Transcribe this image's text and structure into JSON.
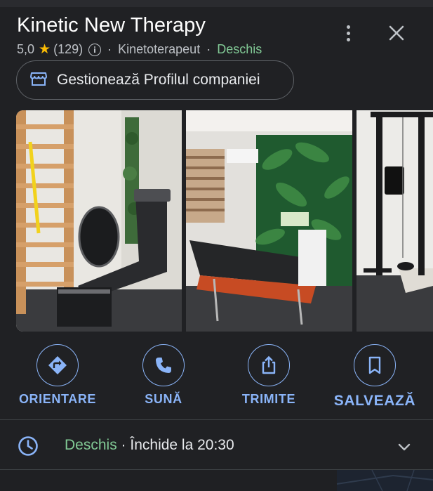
{
  "place": {
    "name": "Kinetic New Therapy",
    "rating": "5,0",
    "reviews": "(129)",
    "category": "Kinetoterapeut",
    "status": "Deschis",
    "separator": "·"
  },
  "header_actions": {
    "more_icon": "more-vert-icon",
    "close_icon": "close-icon"
  },
  "manage_button": {
    "label": "Gestionează Profilul companiei",
    "icon": "storefront-icon"
  },
  "photos": [
    {
      "subject": "wall bars, trampoline and treadmill"
    },
    {
      "subject": "massage table with tropical leaf wallpaper"
    },
    {
      "subject": "pull-up power tower"
    }
  ],
  "actions": [
    {
      "label": "ORIENTARE",
      "icon": "directions-icon"
    },
    {
      "label": "SUNĂ",
      "icon": "phone-icon"
    },
    {
      "label": "TRIMITE",
      "icon": "share-icon"
    },
    {
      "label": "SALVEAZĂ",
      "icon": "bookmark-icon"
    }
  ],
  "hours": {
    "status": "Deschis",
    "separator": " · ",
    "detail": "Închide la 20:30",
    "icon": "clock-icon",
    "expand_icon": "chevron-down-icon"
  },
  "colors": {
    "background": "#202124",
    "accent": "#8ab4f8",
    "open_green": "#81c995",
    "star": "#fbbc04"
  }
}
